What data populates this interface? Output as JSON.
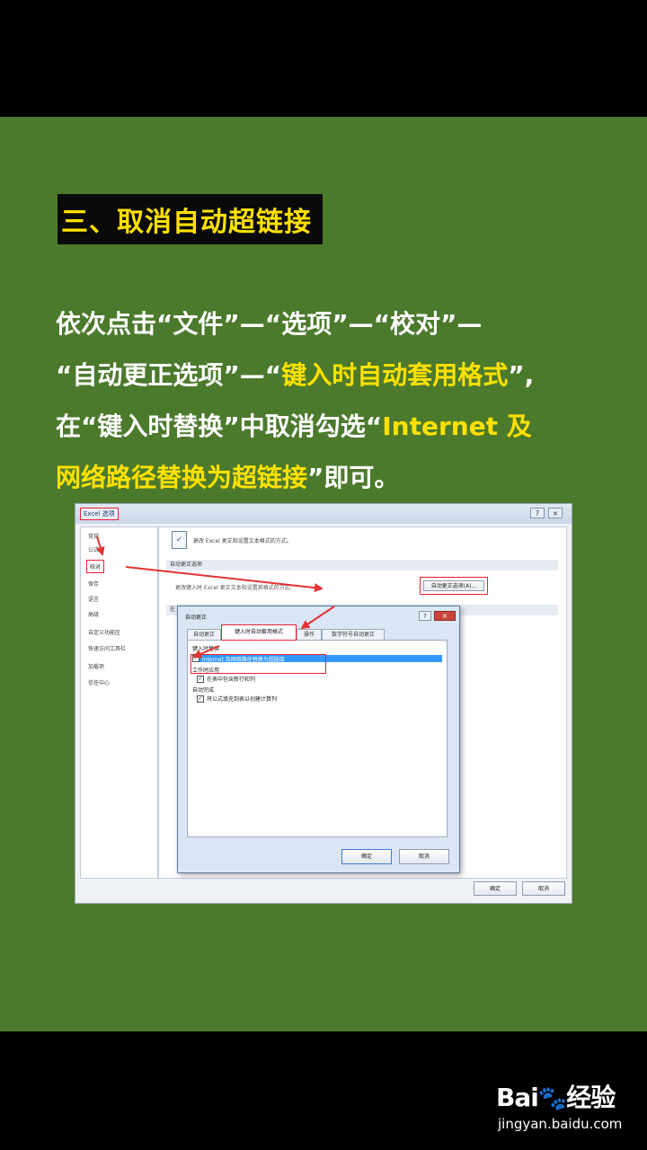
{
  "heading": "三、取消自动超链接",
  "instructions": {
    "line1": "依次点击“文件”—“选项”—“校对”—",
    "line2_a": "“自动更正选项”—“",
    "line2_b": "键入时自动套用格式",
    "line2_c": "”,",
    "line3_a": "在“键入时替换”中取消勾选“",
    "line3_b": "Internet 及",
    "line4_a": "网络路径替换为超链接",
    "line4_b": "”即可。"
  },
  "screenshot": {
    "window_title": "Excel 选项",
    "controls": {
      "help": "?",
      "close": "×"
    },
    "nav": [
      "常规",
      "公式",
      "校对",
      "保存",
      "语言",
      "高级",
      "自定义功能区",
      "快速访问工具栏",
      "加载项",
      "信任中心"
    ],
    "description": "更改 Excel 更正和设置文本格式的方式。",
    "section_autocorrect": "自动更正选项",
    "autocorrect_label": "更改键入时 Excel 更正文本和设置其格式的方式:",
    "autocorrect_button": "自动更正选项(A)...",
    "section_2": "在",
    "ok": "确定",
    "cancel": "取消",
    "dialog": {
      "title": "自动更正",
      "help": "?",
      "close": "×",
      "tabs": [
        "自动更正",
        "键入时自动套用格式",
        "操作",
        "数学符号自动更正"
      ],
      "group1": "键入时替换",
      "option_internet": "Internet 及网络路径替换为超链接",
      "group2": "工作时应用",
      "option_include": "在表中包含新行和列",
      "group3": "自动完成",
      "option_formula": "将公式填充到表以创建计算列",
      "ok": "确定",
      "cancel": "取消"
    }
  },
  "watermark": {
    "logo_a": "Bai",
    "logo_paw": "🐾",
    "logo_b": "经验",
    "url": "jingyan.baidu.com"
  },
  "colors": {
    "green": "#4c7a2d",
    "yellow": "#ffe100",
    "red": "#e23333"
  }
}
